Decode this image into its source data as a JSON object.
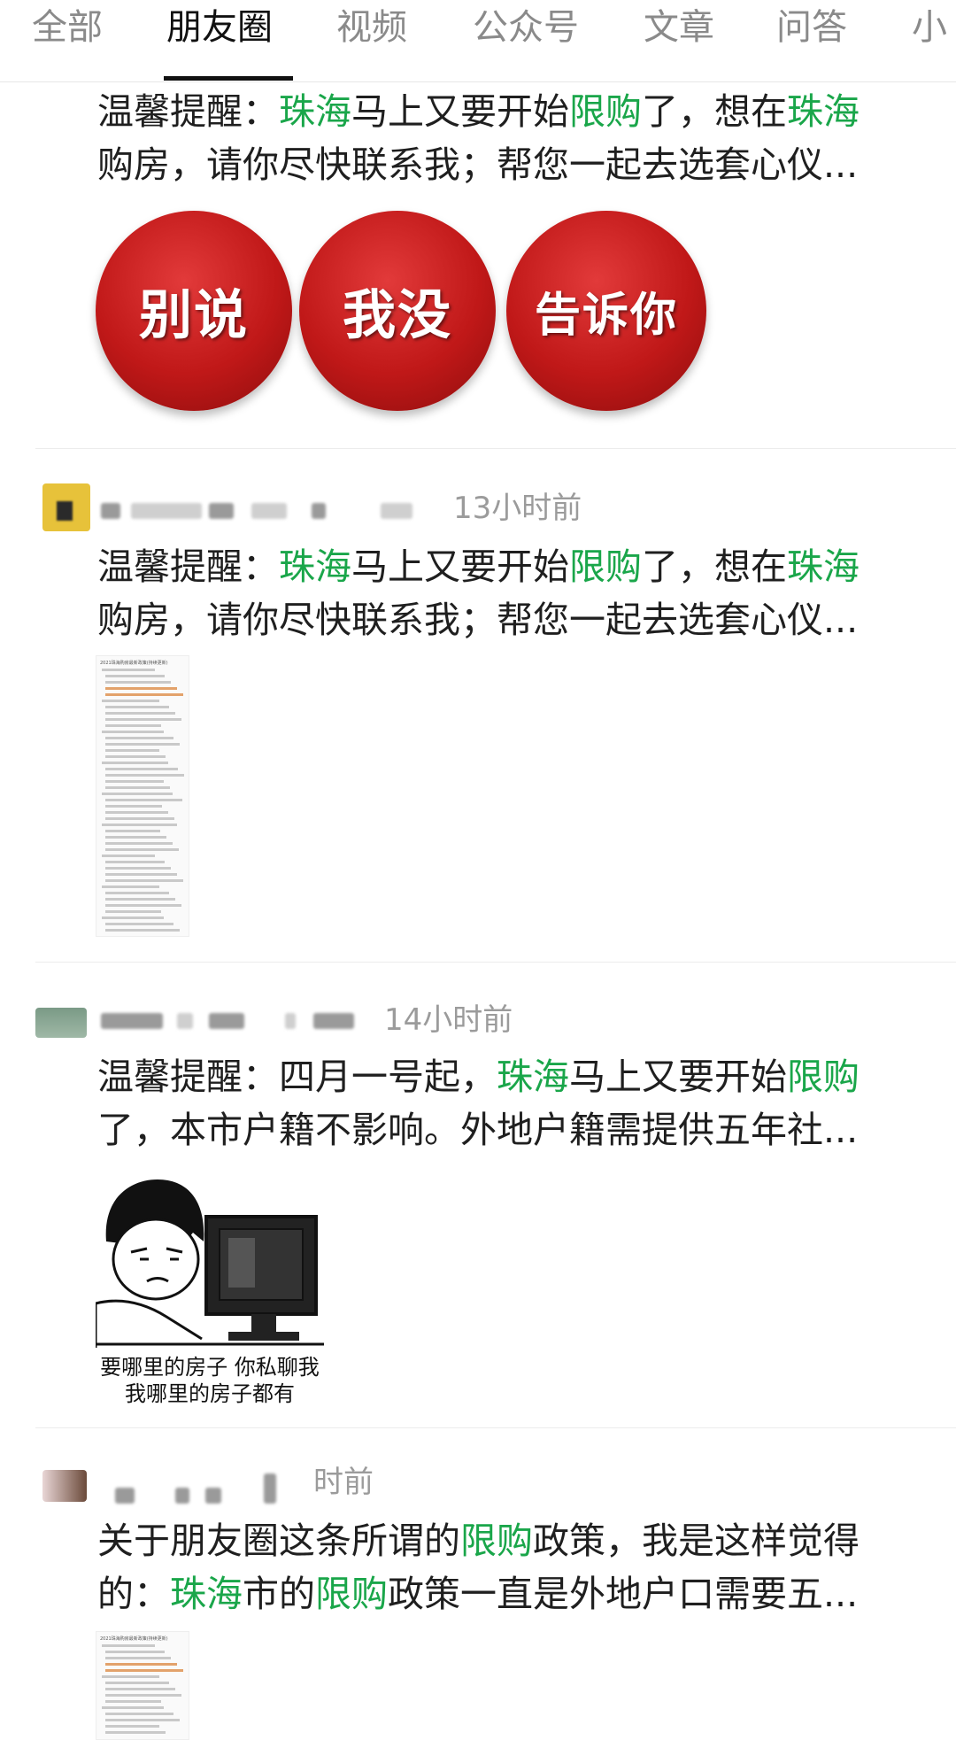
{
  "tabs": [
    "全部",
    "朋友圈",
    "视频",
    "公众号",
    "文章",
    "问答",
    "小"
  ],
  "active_tab": 1,
  "posts": [
    {
      "time": "",
      "text_segments": [
        {
          "t": "温馨提醒："
        },
        {
          "t": "珠海",
          "hl": true
        },
        {
          "t": "马上又要开始"
        },
        {
          "t": "限购",
          "hl": true
        },
        {
          "t": "了，想在"
        },
        {
          "t": "珠海",
          "hl": true
        },
        {
          "t": "\n购房，请你尽快联系我；帮您一起去选套心仪..."
        }
      ],
      "images": [
        "别说",
        "我没",
        "告诉你"
      ]
    },
    {
      "time": "13小时前",
      "text_segments": [
        {
          "t": "温馨提醒："
        },
        {
          "t": "珠海",
          "hl": true
        },
        {
          "t": "马上又要开始"
        },
        {
          "t": "限购",
          "hl": true
        },
        {
          "t": "了，想在"
        },
        {
          "t": "珠海",
          "hl": true
        },
        {
          "t": "\n购房，请你尽快联系我；帮您一起去选套心仪..."
        }
      ],
      "doc_title": "2021珠海购房最新政策(持续更新)"
    },
    {
      "time": "14小时前",
      "text_segments": [
        {
          "t": "温馨提醒：四月一号起，"
        },
        {
          "t": "珠海",
          "hl": true
        },
        {
          "t": "马上又要开始"
        },
        {
          "t": "限购",
          "hl": true
        },
        {
          "t": "\n了，本市户籍不影响。外地户籍需提供五年社..."
        }
      ],
      "meme_caption": [
        "要哪里的房子 你私聊我",
        "我哪里的房子都有"
      ]
    },
    {
      "time": "时前",
      "text_segments": [
        {
          "t": "关于朋友圈这条所谓的"
        },
        {
          "t": "限购",
          "hl": true
        },
        {
          "t": "政策，我是这样觉得\n的："
        },
        {
          "t": "珠海",
          "hl": true
        },
        {
          "t": "市的"
        },
        {
          "t": "限购",
          "hl": true
        },
        {
          "t": "政策一直是外地户口需要五..."
        }
      ],
      "doc_title": "2021珠海购房最新政策(持续更新)"
    }
  ],
  "colors": {
    "highlight": "#1aa64a",
    "tab_active": "#111111",
    "tab_inactive": "#8a8a8a"
  }
}
